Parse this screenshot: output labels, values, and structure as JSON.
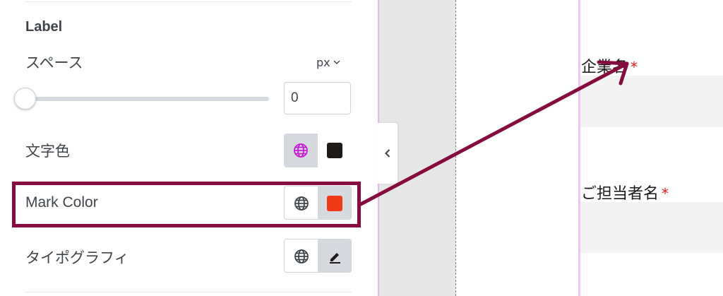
{
  "panel": {
    "section_title": "Label",
    "spacing": {
      "label": "スペース",
      "unit": "px",
      "value": "0",
      "slider_fraction": 0.0
    },
    "text_color": {
      "label": "文字色",
      "swatch_color": "#1e1a19"
    },
    "mark_color": {
      "label": "Mark Color",
      "swatch_color": "#ee3a16"
    },
    "typography": {
      "label": "タイポグラフィ"
    }
  },
  "canvas": {
    "fields": [
      {
        "label": "企業名",
        "required_mark": "*"
      },
      {
        "label": "ご担当者名",
        "required_mark": "*"
      }
    ]
  },
  "colors": {
    "highlight_border": "#860c3f",
    "arrow": "#860c3f",
    "global_active": "#c81bd7",
    "required": "#e21b1b"
  }
}
